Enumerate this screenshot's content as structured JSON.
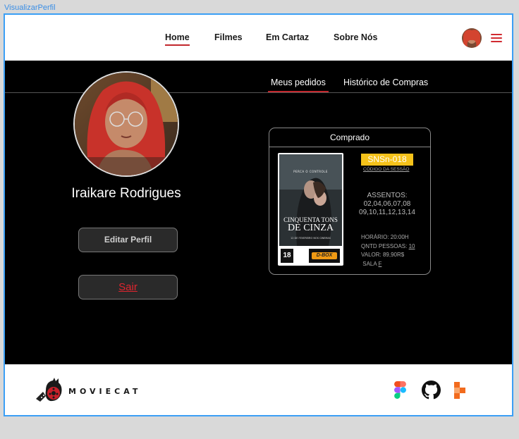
{
  "frame": {
    "label": "VisualizarPerfil"
  },
  "nav": {
    "items": [
      {
        "label": "Home",
        "active": true
      },
      {
        "label": "Filmes",
        "active": false
      },
      {
        "label": "Em Cartaz",
        "active": false
      },
      {
        "label": "Sobre Nós",
        "active": false
      }
    ],
    "menu_icon": "hamburger-menu-icon",
    "accent_color": "#c2272d"
  },
  "profile": {
    "name": "Iraikare Rodrigues",
    "edit_label": "Editar Perfil",
    "logout_label": "Sair"
  },
  "tabs": [
    {
      "label": "Meus pedidos",
      "active": true
    },
    {
      "label": "Histórico de Compras",
      "active": false
    }
  ],
  "order": {
    "status": "Comprado",
    "poster": {
      "tagline": "PERCA O CONTROLE",
      "title_line1": "CINQUENTA TONS",
      "title_line2": "DE CINZA",
      "date": "12 DE FEVEREIRO NOS CINEMAS",
      "rating": "18",
      "format": "D-BOX"
    },
    "session_code": "SNSn-018",
    "session_label": "CÓDIGO DA SESSÃO",
    "seats_label": "ASSENTOS:",
    "seats_line1": "02,04,06,07,08",
    "seats_line2": "09,10,11,12,13,14",
    "time": "HORÁRIO: 20:00H",
    "people_label": "QNTD PESSOAS:",
    "people_value": "10",
    "price": "VALOR: 89,90R$",
    "room_label": "SALA",
    "room_value": "F",
    "code_color": "#f5c21a"
  },
  "footer": {
    "logo_text": "MOVIECAT",
    "icons": [
      "figma-icon",
      "github-icon",
      "stackedit-icon"
    ]
  }
}
